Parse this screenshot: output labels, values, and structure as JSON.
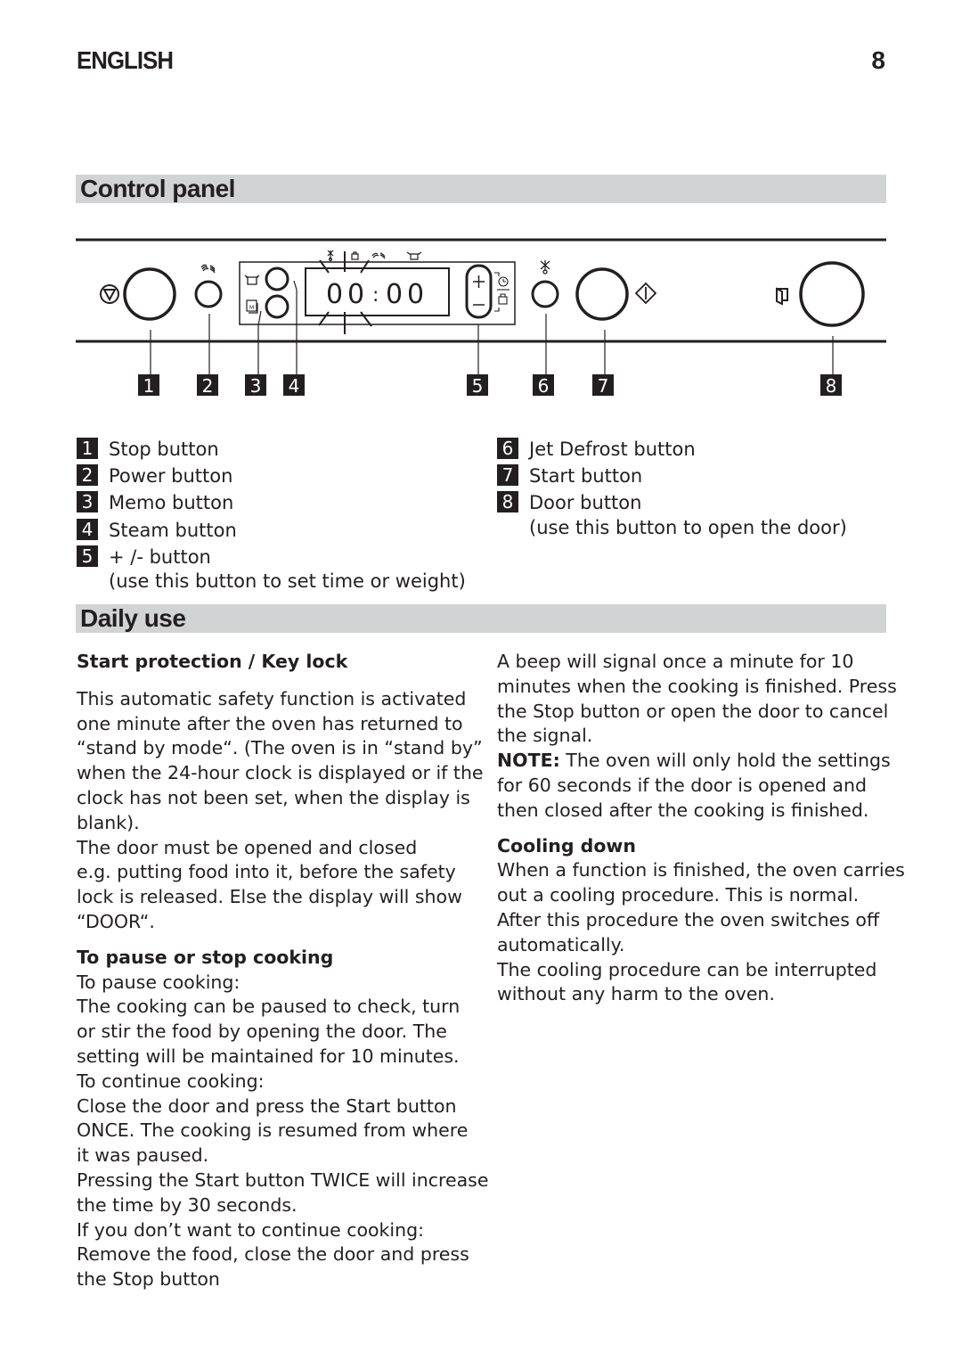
{
  "header": {
    "language": "ENGLISH",
    "page_number": "8"
  },
  "control_panel": {
    "title": "Control panel",
    "display": {
      "time": "00:00",
      "digits": [
        "0",
        "0",
        "0",
        "0"
      ],
      "separator": ":"
    },
    "callout_numbers": [
      "1",
      "2",
      "3",
      "4",
      "5",
      "6",
      "7",
      "8"
    ],
    "legend_left": [
      {
        "num": "1",
        "label": "Stop button"
      },
      {
        "num": "2",
        "label": "Power button"
      },
      {
        "num": "3",
        "label": "Memo button"
      },
      {
        "num": "4",
        "label": "Steam button"
      },
      {
        "num": "5",
        "label": "+ /- button",
        "note": "(use this button to set time or weight)"
      }
    ],
    "legend_right": [
      {
        "num": "6",
        "label": "Jet Defrost button"
      },
      {
        "num": "7",
        "label": "Start button"
      },
      {
        "num": "8",
        "label": "Door button",
        "note": "(use this button to open the door)"
      }
    ],
    "icons": [
      "stop-icon",
      "power-icon",
      "steam-pot-icon",
      "memo-icon",
      "defrost-icon",
      "weight-icon",
      "timer-icon",
      "start-icon",
      "door-icon"
    ]
  },
  "daily_use": {
    "title": "Daily use",
    "start_protection": {
      "heading": "Start protection / Key lock",
      "lines": [
        "This automatic safety function is activated",
        "one minute after the oven has returned to",
        "“stand by mode“. (The oven is in “stand by”",
        "when the 24-hour clock is displayed or if the",
        "clock has not been set, when the display is",
        "blank).",
        "The door must be opened and closed",
        "e.g. putting food into it, before the safety",
        "lock is released. Else the display will show",
        "“DOOR“."
      ]
    },
    "pause_stop": {
      "heading": "To pause or stop cooking",
      "lines": [
        "To pause cooking:",
        "The cooking can be paused to check, turn",
        "or stir the food by opening the door. The",
        "setting will be maintained for  10 minutes.",
        "To continue cooking:",
        "Close the door and press the Start button",
        "ONCE. The cooking is resumed from where",
        "it was paused.",
        "Pressing the Start button TWICE will increase",
        "the time by 30 seconds.",
        "If you don’t want to continue cooking:",
        "Remove the food, close the door and press",
        "the Stop button"
      ]
    },
    "beep": {
      "lines": [
        "A beep will signal once a minute for  10",
        "minutes when the cooking is finished. Press",
        "the Stop button or open the door to cancel",
        "the signal."
      ],
      "note_label": "NOTE:",
      "note_lines": [
        " The oven will only hold the settings",
        "for 60 seconds if the door is opened and",
        "then closed after the cooking is finished."
      ]
    },
    "cooling_down": {
      "heading": "Cooling down",
      "lines": [
        "When a function is finished, the oven carries",
        "out a cooling procedure. This is normal.",
        "After this procedure the oven switches off",
        "automatically.",
        "The cooling procedure can be interrupted",
        "without any harm to the oven."
      ]
    }
  }
}
